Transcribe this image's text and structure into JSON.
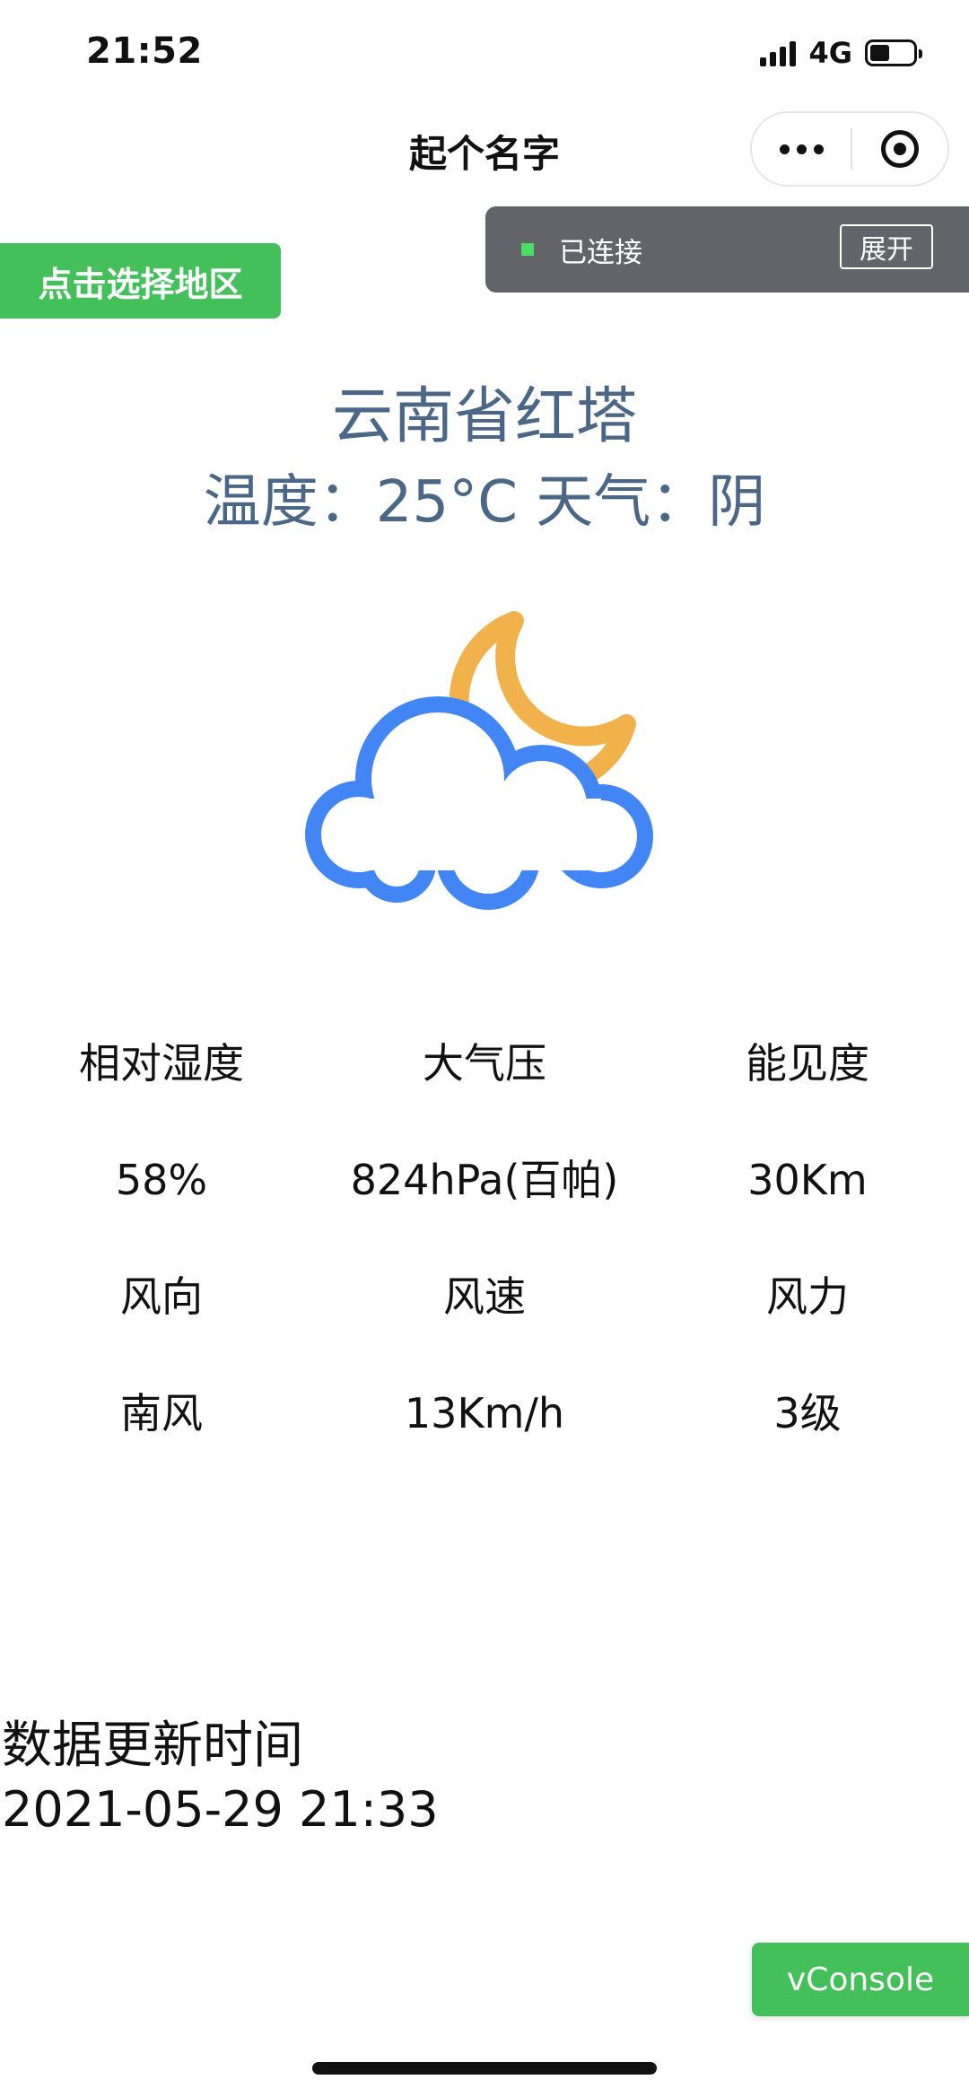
{
  "status_bar": {
    "time": "21:52",
    "network": "4G",
    "battery_level": 0.45
  },
  "nav": {
    "title": "起个名字"
  },
  "region_button": {
    "label": "点击选择地区"
  },
  "connection": {
    "status": "已连接",
    "expand_label": "展开",
    "status_color": "#4ce063"
  },
  "weather": {
    "location": "云南省红塔",
    "summary": "温度：25°C 天气：阴",
    "icon": "moon-cloud-icon",
    "colors": {
      "text": "#4a6788",
      "cloud": "#4285f4",
      "moon": "#f2b24b"
    }
  },
  "details": {
    "humidity_label": "相对湿度",
    "pressure_label": "大气压",
    "visibility_label": "能见度",
    "humidity_value": "58%",
    "pressure_value": "824hPa(百帕)",
    "visibility_value": "30Km",
    "wind_direction_label": "风向",
    "wind_speed_label": "风速",
    "wind_force_label": "风力",
    "wind_direction_value": "南风",
    "wind_speed_value": "13Km/h",
    "wind_force_value": "3级"
  },
  "update": {
    "label": "数据更新时间",
    "value": "2021-05-29 21:33"
  },
  "vconsole": {
    "label": "vConsole",
    "color": "#43c05a"
  }
}
